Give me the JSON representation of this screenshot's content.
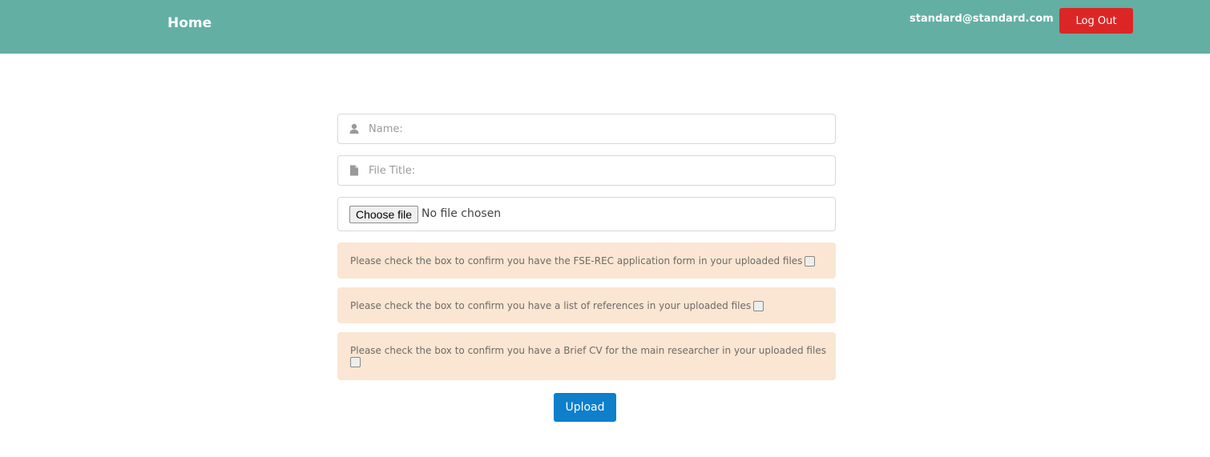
{
  "navbar": {
    "brand": "Home",
    "user_email": "standard@standard.com",
    "logout_label": "Log Out",
    "background": "#63afa3",
    "logout_color": "#dc2626"
  },
  "form": {
    "name_field": {
      "placeholder": "Name:",
      "value": "",
      "icon": "user-icon"
    },
    "file_title_field": {
      "placeholder": "File Title:",
      "value": "",
      "icon": "file-icon"
    },
    "file_input": {
      "button_label": "Choose file",
      "status": "No file chosen"
    },
    "confirmations": [
      {
        "text": "Please check the box to confirm you have the FSE-REC application form in your uploaded files",
        "checked": false
      },
      {
        "text": "Please check the box to confirm you have a list of references in your uploaded files",
        "checked": false
      },
      {
        "text": "Please check the box to confirm you have a Brief CV for the main researcher in your uploaded files",
        "checked": false
      }
    ],
    "confirmation_background": "#fae6d3",
    "upload_label": "Upload",
    "upload_color": "#0d7fcb"
  }
}
